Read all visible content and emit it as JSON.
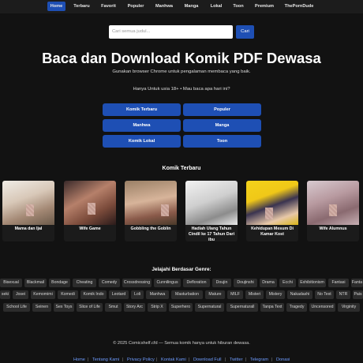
{
  "nav": {
    "items": [
      {
        "label": "Home",
        "active": true
      },
      {
        "label": "Terbaru"
      },
      {
        "label": "Favorit"
      },
      {
        "label": "Populer"
      },
      {
        "label": "Manhwa"
      },
      {
        "label": "Manga"
      },
      {
        "label": "Lokal"
      },
      {
        "label": "Toon"
      },
      {
        "label": "Premium"
      },
      {
        "label": "ThePornDude"
      }
    ]
  },
  "search": {
    "placeholder": "Cari semua judul...",
    "button": "Cari"
  },
  "hero": {
    "title": "Baca dan Download Komik PDF Dewasa",
    "subtitle": "Gunakan browser Chrome untuk pengalaman membaca yang baik.",
    "age_note": "Hanya Untuk usia 18+ • Mau baca apa hari ini?"
  },
  "quick_links": [
    "Komik Terbaru",
    "Populer",
    "Manhwa",
    "Manga",
    "Komik Lokal",
    "Toon"
  ],
  "latest": {
    "title": "Komik Terbaru",
    "cards": [
      {
        "title": "Mama dan Ijal"
      },
      {
        "title": "Wife Game"
      },
      {
        "title": "Gobbling the Goblin"
      },
      {
        "title": "Hadiah Ulang Tahun Cindil ke 17 Tahun Dari ibu"
      },
      {
        "title": "Kehidupan Mesum Di Kamar Kost"
      },
      {
        "title": "Wife Alumnus"
      }
    ]
  },
  "genres": {
    "title": "Jelajahi Berdasar Genre:",
    "row1": [
      "Bisexual",
      "Blackmail",
      "Bondage",
      "Cheating",
      "Comedy",
      "Crossdressing",
      "Cunnilingus",
      "Defloration",
      "Doujin",
      "Doujinshi",
      "Drama",
      "Ecchi",
      "Exhibitionism",
      "Fantasi",
      "Fanta"
    ],
    "row2": [
      "seki",
      "Josei",
      "Kemomimi",
      "Komedi",
      "Komik Indo",
      "Leotard",
      "Loli",
      "Manhwa",
      "Masturbation",
      "Mature",
      "MILF",
      "Misteri",
      "Mistery",
      "Nakadashi",
      "No Text",
      "NTR",
      "Pais"
    ],
    "row3": [
      "School Life",
      "Seinen",
      "Sex Toys",
      "Slice of Life",
      "Smut",
      "Story Arc",
      "Strip X",
      "Superhero",
      "Supernatural",
      "Supernaturall",
      "Tanpa Text",
      "Tragedy",
      "Uncensored",
      "Virginity"
    ]
  },
  "footer": {
    "copyright": "© 2025 Comicshelf.cfd — Semua komik hanya untuk hiburan dewasa.",
    "links": [
      "Home",
      "Tentang Kami",
      "Privacy Policy",
      "Kontak Kami",
      "Download Full",
      "Twitter",
      "Telegram",
      "Donasi"
    ]
  },
  "colors": {
    "accent": "#1e4fb4",
    "background": "#121212",
    "link": "#6e9cff"
  }
}
